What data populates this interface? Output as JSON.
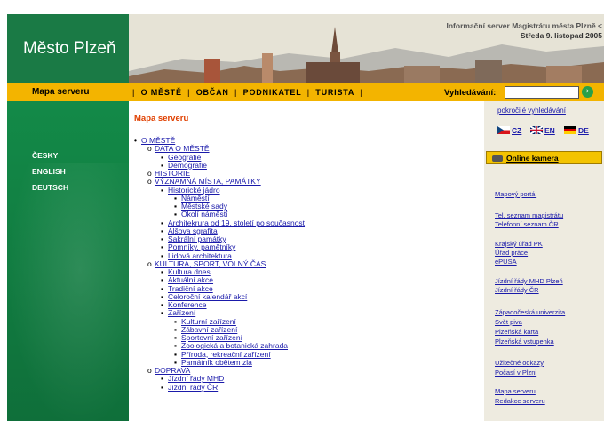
{
  "header": {
    "site_name": "Město Plzeň",
    "info_line": "Informační server Magistrátu města Plzně <",
    "date_line": "Středa 9. listopad 2005"
  },
  "navbar": {
    "title": "Mapa serveru",
    "links": [
      "O MĚSTĚ",
      "OBČAN",
      "PODNIKATEL",
      "TURISTA"
    ],
    "search_label": "Vyhledávání:",
    "search_value": "",
    "advanced_search": "pokročilé vyhledávání"
  },
  "languages": [
    "ČESKY",
    "ENGLISH",
    "DEUTSCH"
  ],
  "flags": [
    "CZ",
    "EN",
    "DE"
  ],
  "colors": {
    "green": "#138a48",
    "yellow": "#f3b400",
    "link": "#1a1aaa",
    "title": "#e04000"
  },
  "content": {
    "title": "Mapa serveru",
    "tree": [
      {
        "level": 0,
        "bullet": "•",
        "text": "O MĚSTĚ"
      },
      {
        "level": 1,
        "bullet": "o",
        "text": "DATA O MĚSTĚ"
      },
      {
        "level": 2,
        "bullet": "▪",
        "text": "Geografie"
      },
      {
        "level": 2,
        "bullet": "▪",
        "text": "Demografie"
      },
      {
        "level": 1,
        "bullet": "o",
        "text": "HISTORIE"
      },
      {
        "level": 1,
        "bullet": "o",
        "text": "VÝZNAMNÁ MÍSTA, PAMÁTKY"
      },
      {
        "level": 2,
        "bullet": "▪",
        "text": "Historické jádro"
      },
      {
        "level": 3,
        "bullet": "▪",
        "text": "Náměstí"
      },
      {
        "level": 3,
        "bullet": "▪",
        "text": "Městské sady"
      },
      {
        "level": 3,
        "bullet": "▪",
        "text": "Okolí náměstí"
      },
      {
        "level": 2,
        "bullet": "▪",
        "text": "Architekrura od 19. století po současnost"
      },
      {
        "level": 2,
        "bullet": "▪",
        "text": "Alšova sgrafita"
      },
      {
        "level": 2,
        "bullet": "▪",
        "text": "Sakrální památky"
      },
      {
        "level": 2,
        "bullet": "▪",
        "text": "Pomníky, pamětníky"
      },
      {
        "level": 2,
        "bullet": "▪",
        "text": "Lidová architektura"
      },
      {
        "level": 1,
        "bullet": "o",
        "text": "KULTURA, SPORT, VOLNÝ ČAS"
      },
      {
        "level": 2,
        "bullet": "▪",
        "text": "Kultura dnes"
      },
      {
        "level": 2,
        "bullet": "▪",
        "text": "Aktuální akce"
      },
      {
        "level": 2,
        "bullet": "▪",
        "text": "Tradiční akce"
      },
      {
        "level": 2,
        "bullet": "▪",
        "text": "Celoroční kalendář akcí"
      },
      {
        "level": 2,
        "bullet": "▪",
        "text": "Konference"
      },
      {
        "level": 2,
        "bullet": "▪",
        "text": "Zařízení"
      },
      {
        "level": 3,
        "bullet": "▪",
        "text": "Kulturní zařízení"
      },
      {
        "level": 3,
        "bullet": "▪",
        "text": "Zábavní zařízení"
      },
      {
        "level": 3,
        "bullet": "▪",
        "text": "Sportovní zařízení"
      },
      {
        "level": 3,
        "bullet": "▪",
        "text": "Zoologická a botanická zahrada"
      },
      {
        "level": 3,
        "bullet": "▪",
        "text": "Příroda, rekreační zařízení"
      },
      {
        "level": 3,
        "bullet": "▪",
        "text": "Památník obětem zla"
      },
      {
        "level": 1,
        "bullet": "o",
        "text": "DOPRAVA"
      },
      {
        "level": 2,
        "bullet": "▪",
        "text": "Jízdní řády MHD"
      },
      {
        "level": 2,
        "bullet": "▪",
        "text": "Jízdní řády ČR"
      }
    ]
  },
  "right": {
    "camera": "Online kamera",
    "links": [
      "Mapový portál",
      "Tel. seznam magistrátu",
      "Telefonní seznam ČR",
      "Krajský úřad PK",
      "Úřad práce",
      "ePUSA",
      "Jízdní řády MHD Plzeň",
      "Jízdní řády ČR",
      "Západočeská univerzita",
      "Svět piva",
      "Plzeňská karta",
      "Plzeňská vstupenka",
      "Užitečné odkazy",
      "Počasí v Plzni",
      "Mapa serveru",
      "Redakce serveru"
    ]
  }
}
